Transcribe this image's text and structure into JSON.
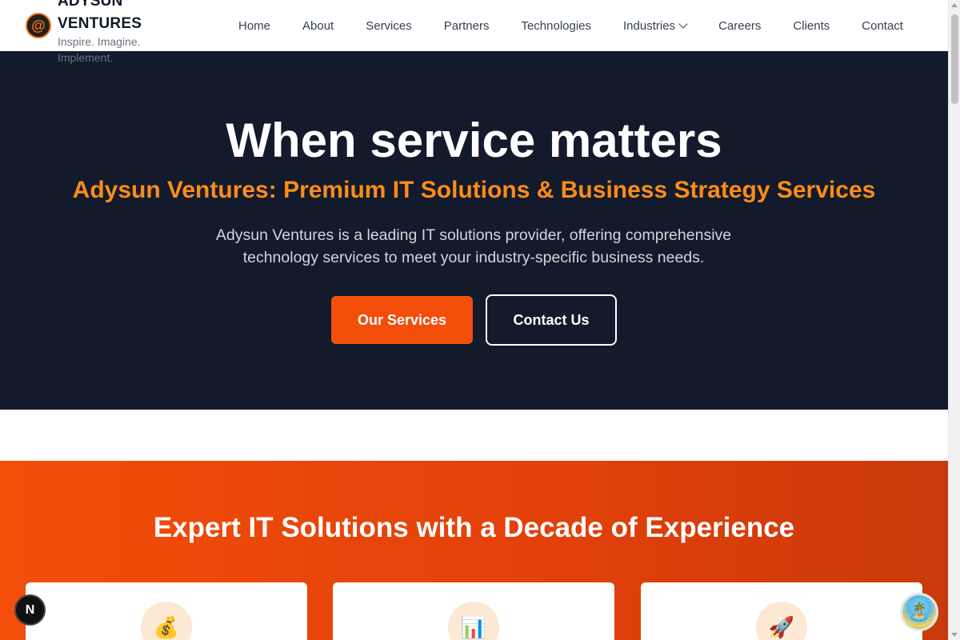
{
  "header": {
    "logo_symbol": "@",
    "brand_name": "ADYSUN VENTURES",
    "tagline": "Inspire. Imagine. Implement.",
    "nav": [
      {
        "label": "Home"
      },
      {
        "label": "About"
      },
      {
        "label": "Services"
      },
      {
        "label": "Partners"
      },
      {
        "label": "Technologies"
      },
      {
        "label": "Industries",
        "has_dropdown": true
      },
      {
        "label": "Careers"
      },
      {
        "label": "Clients"
      },
      {
        "label": "Contact"
      }
    ]
  },
  "hero": {
    "title": "When service matters",
    "subtitle": "Adysun Ventures: Premium IT Solutions & Business Strategy Services",
    "description": "Adysun Ventures is a leading IT solutions provider, offering comprehensive technology services to meet your industry-specific business needs.",
    "primary_button": "Our Services",
    "secondary_button": "Contact Us"
  },
  "expert": {
    "title": "Expert IT Solutions with a Decade of Experience",
    "cards": [
      {
        "icon": "money-bag-icon",
        "glyph": "💰"
      },
      {
        "icon": "bar-chart-icon",
        "glyph": "📊"
      },
      {
        "icon": "rocket-icon",
        "glyph": "🚀"
      }
    ]
  },
  "floating": {
    "next_badge": "N",
    "beach_glyph": "🏝️"
  },
  "colors": {
    "hero_bg": "#131a2b",
    "accent_orange": "#f24e0a",
    "subtitle_orange": "#fb8c1a"
  }
}
